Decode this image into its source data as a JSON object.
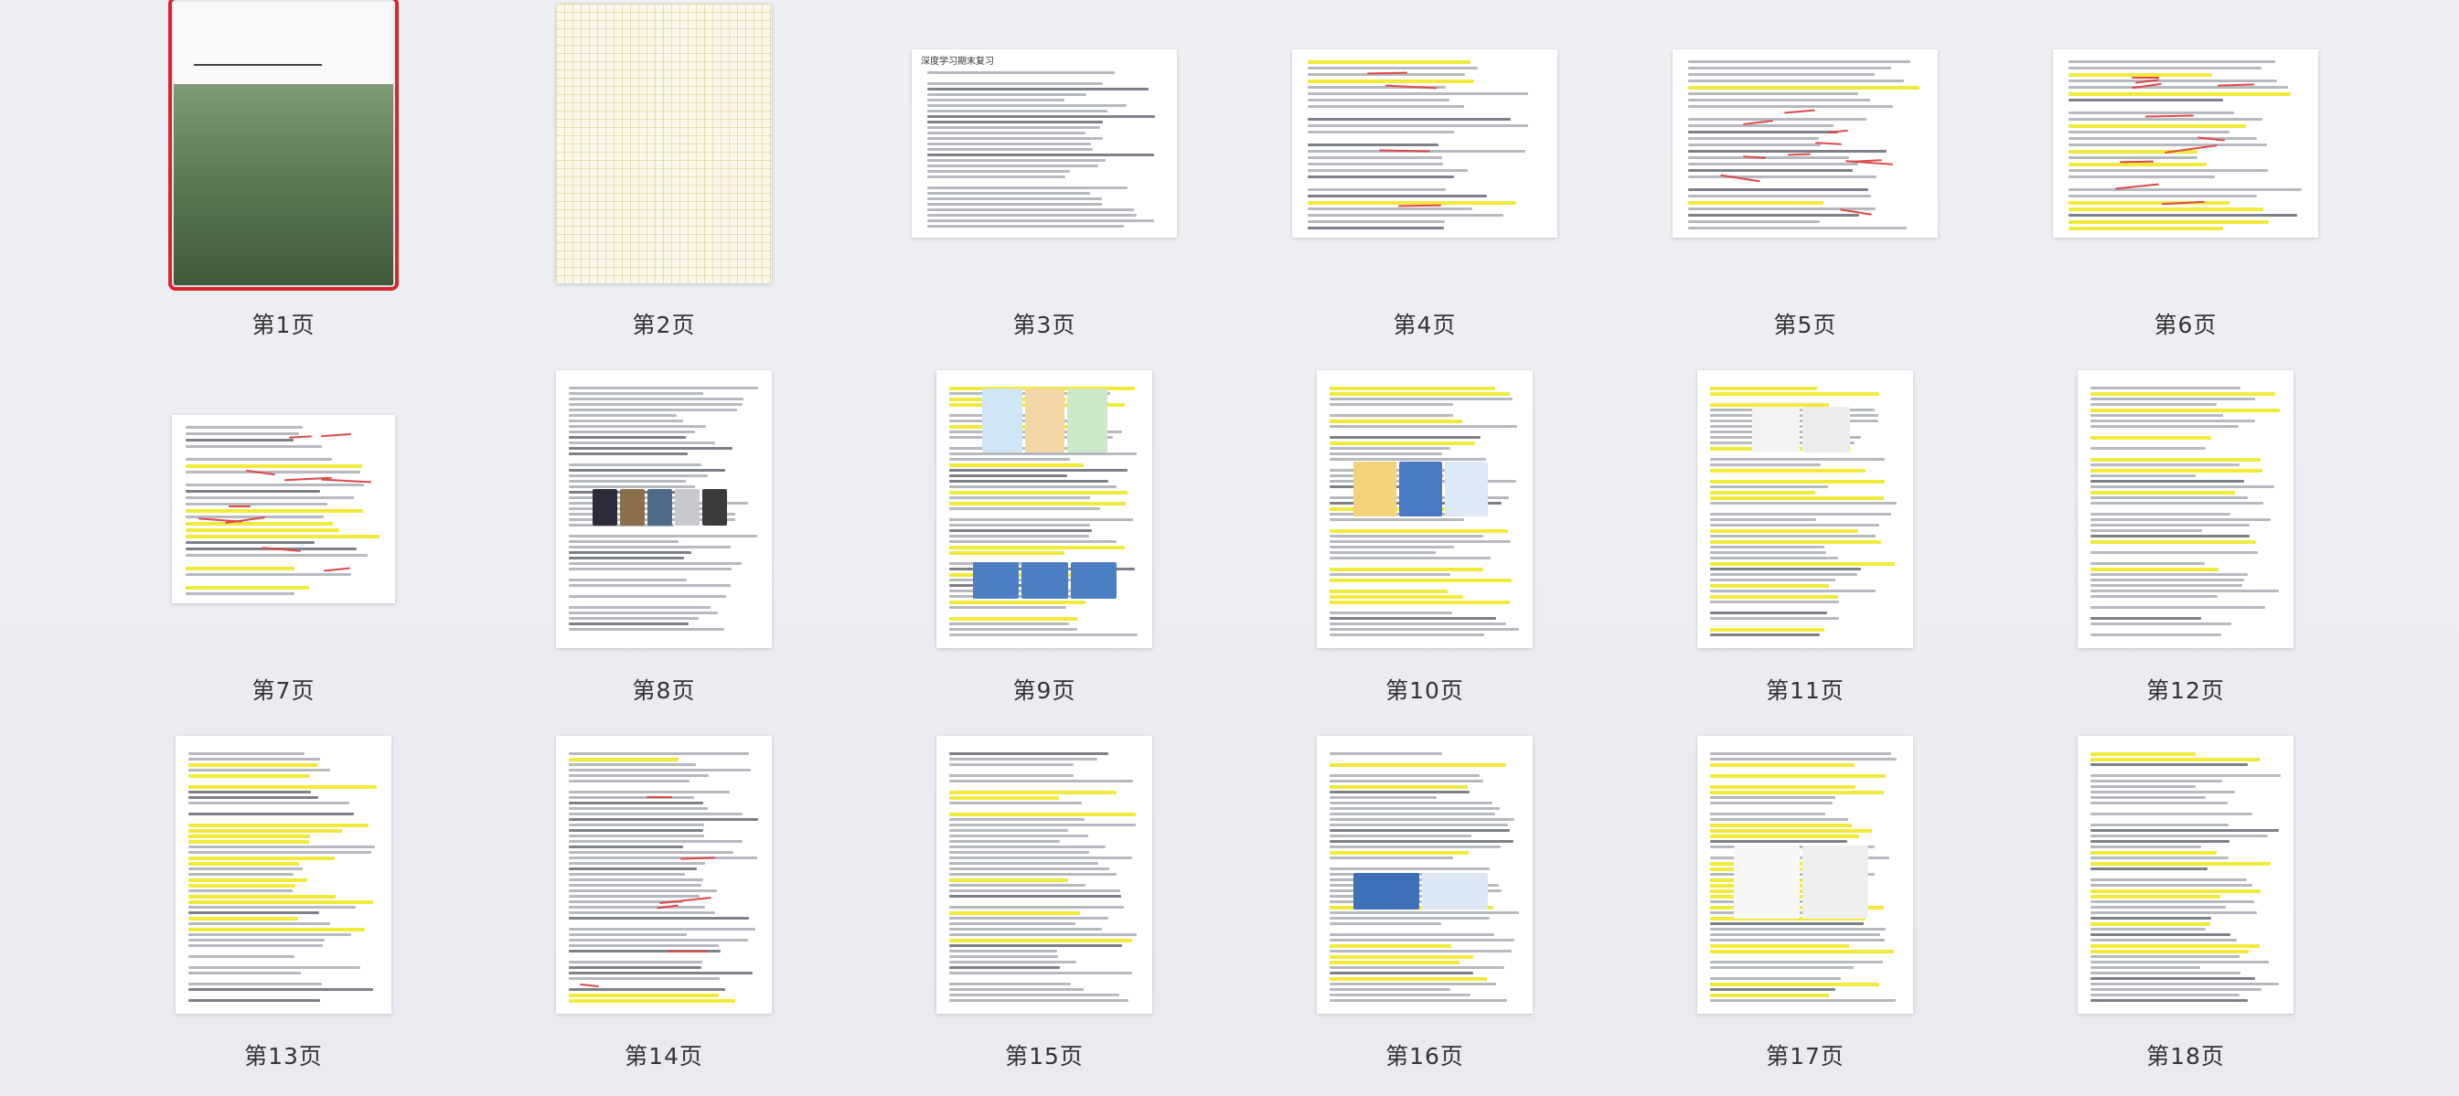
{
  "pages": [
    {
      "label": "第1页",
      "kind": "cover",
      "selected": true
    },
    {
      "label": "第2页",
      "kind": "grid"
    },
    {
      "label": "第3页",
      "kind": "landscape-text",
      "title": "深度学习期末复习"
    },
    {
      "label": "第4页",
      "kind": "landscape-text"
    },
    {
      "label": "第5页",
      "kind": "landscape-text"
    },
    {
      "label": "第6页",
      "kind": "landscape-text"
    },
    {
      "label": "第7页",
      "kind": "landscape-text"
    },
    {
      "label": "第8页",
      "kind": "portrait-text"
    },
    {
      "label": "第9页",
      "kind": "portrait-text"
    },
    {
      "label": "第10页",
      "kind": "portrait-text"
    },
    {
      "label": "第11页",
      "kind": "portrait-text"
    },
    {
      "label": "第12页",
      "kind": "portrait-text"
    },
    {
      "label": "第13页",
      "kind": "portrait-text"
    },
    {
      "label": "第14页",
      "kind": "portrait-text"
    },
    {
      "label": "第15页",
      "kind": "portrait-text"
    },
    {
      "label": "第16页",
      "kind": "portrait-text"
    },
    {
      "label": "第17页",
      "kind": "portrait-text"
    },
    {
      "label": "第18页",
      "kind": "portrait-text"
    }
  ],
  "colors": {
    "selected_border": "#d9252f",
    "highlight": "#f1ea3b",
    "annotation": "#d63a3a",
    "cover_green": "#4f6b48"
  }
}
